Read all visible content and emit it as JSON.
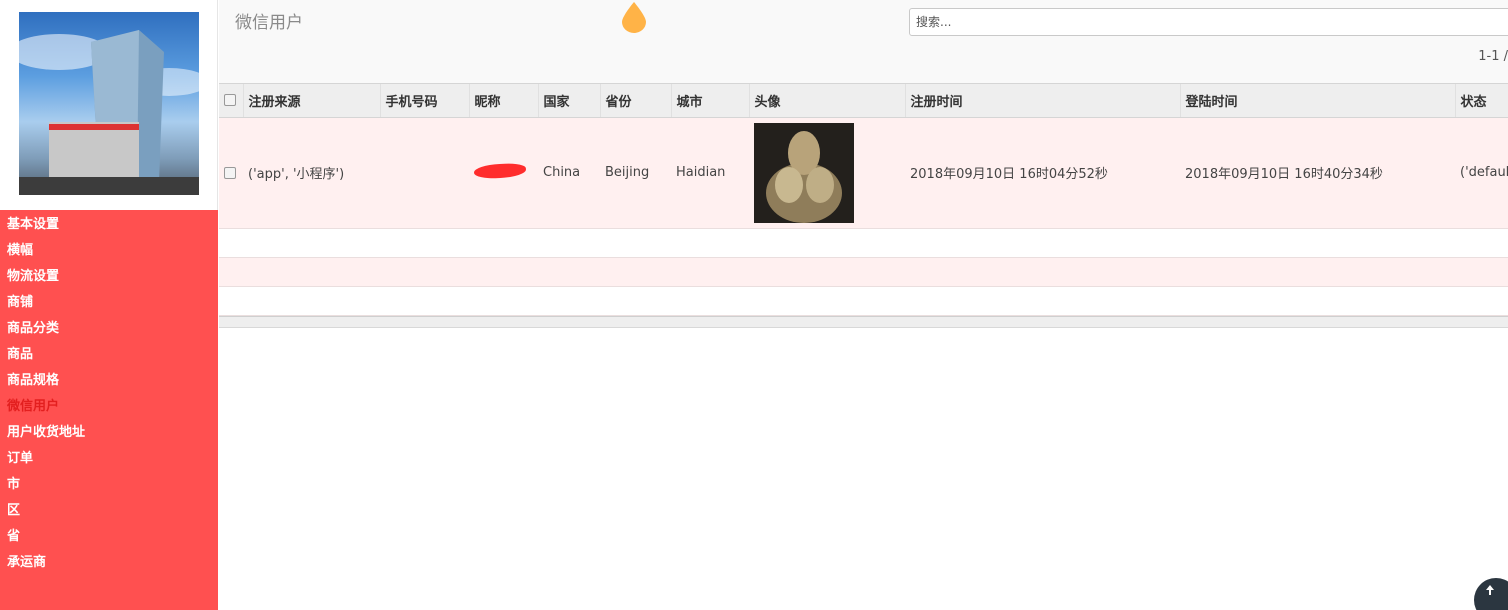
{
  "sidebar": {
    "items": [
      {
        "label": "基本设置"
      },
      {
        "label": "横幅"
      },
      {
        "label": "物流设置"
      },
      {
        "label": "商铺"
      },
      {
        "label": "商品分类"
      },
      {
        "label": "商品"
      },
      {
        "label": "商品规格"
      },
      {
        "label": "微信用户",
        "active": true
      },
      {
        "label": "用户收货地址"
      },
      {
        "label": "订单"
      },
      {
        "label": "市"
      },
      {
        "label": "区"
      },
      {
        "label": "省"
      },
      {
        "label": "承运商"
      }
    ]
  },
  "header": {
    "title": "微信用户",
    "search_placeholder": "搜索...",
    "pagination": "1-1 /"
  },
  "table": {
    "columns": [
      "注册来源",
      "手机号码",
      "昵称",
      "国家",
      "省份",
      "城市",
      "头像",
      "注册时间",
      "登陆时间",
      "状态"
    ],
    "rows": [
      {
        "source": "('app', '小程序')",
        "phone": "",
        "nickname": "",
        "country": "China",
        "province": "Beijing",
        "city": "Haidian",
        "register_time": "2018年09月10日 16时04分52秒",
        "login_time": "2018年09月10日 16时40分34秒",
        "status": "('default'"
      }
    ]
  },
  "colors": {
    "sidebar_bg": "#ff5050",
    "active_menu": "#e31f1f",
    "row_highlight": "#fff0f0",
    "drop_icon": "#ffb347"
  }
}
